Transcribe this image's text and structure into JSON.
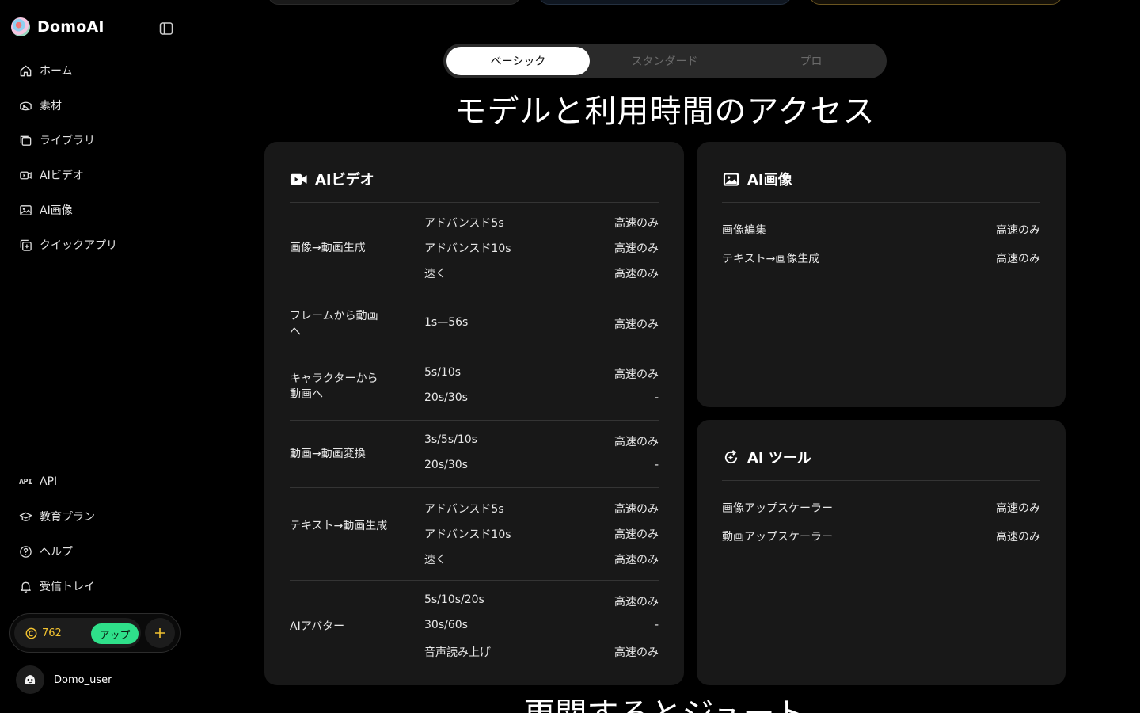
{
  "brand": {
    "name": "DomoAI"
  },
  "nav": {
    "items": [
      {
        "label": "ホーム",
        "icon": "home-icon"
      },
      {
        "label": "素材",
        "icon": "assets-icon"
      },
      {
        "label": "ライブラリ",
        "icon": "library-icon"
      },
      {
        "label": "AIビデオ",
        "icon": "video-icon"
      },
      {
        "label": "AI画像",
        "icon": "image-icon"
      },
      {
        "label": "クイックアプリ",
        "icon": "quick-app-icon"
      }
    ],
    "bottom": [
      {
        "label": "API",
        "icon": "api-icon"
      },
      {
        "label": "教育プラン",
        "icon": "education-icon"
      },
      {
        "label": "ヘルプ",
        "icon": "help-icon"
      },
      {
        "label": "受信トレイ",
        "icon": "bell-icon"
      }
    ]
  },
  "credits": {
    "count": "762",
    "upgrade_label": "アップ"
  },
  "user": {
    "name": "Domo_user"
  },
  "tabs": [
    {
      "label": "ベーシック",
      "active": true
    },
    {
      "label": "スタンダード",
      "active": false
    },
    {
      "label": "プロ",
      "active": false
    }
  ],
  "section_title": "モデルと利用時間のアクセス",
  "video_card": {
    "title": "AIビデオ",
    "groups": [
      {
        "name": "画像→動画生成",
        "rows": [
          {
            "option": "アドバンスド5s",
            "speed": "高速のみ"
          },
          {
            "option": "アドバンスド10s",
            "speed": "高速のみ"
          },
          {
            "option": "速く",
            "speed": "高速のみ"
          }
        ]
      },
      {
        "name": "フレームから動画へ",
        "rows": [
          {
            "option": "1s—56s",
            "speed": "高速のみ"
          }
        ]
      },
      {
        "name": "キャラクターから動画へ",
        "rows": [
          {
            "option": "5s/10s",
            "speed": "高速のみ"
          },
          {
            "option": "20s/30s",
            "speed": "-"
          }
        ]
      },
      {
        "name": "動画→動画変換",
        "rows": [
          {
            "option": "3s/5s/10s",
            "speed": "高速のみ"
          },
          {
            "option": "20s/30s",
            "speed": "-"
          }
        ]
      },
      {
        "name": "テキスト→動画生成",
        "rows": [
          {
            "option": "アドバンスド5s",
            "speed": "高速のみ"
          },
          {
            "option": "アドバンスド10s",
            "speed": "高速のみ"
          },
          {
            "option": "速く",
            "speed": "高速のみ"
          }
        ]
      },
      {
        "name": "AIアバター",
        "rows": [
          {
            "option": "5s/10s/20s",
            "speed": "高速のみ"
          },
          {
            "option": "30s/60s",
            "speed": "-"
          },
          {
            "option": "音声読み上げ",
            "speed": "高速のみ"
          }
        ]
      }
    ]
  },
  "image_card": {
    "title": "AI画像",
    "rows": [
      {
        "label": "画像編集",
        "speed": "高速のみ"
      },
      {
        "label": "テキスト→画像生成",
        "speed": "高速のみ"
      }
    ]
  },
  "tools_card": {
    "title": "AI ツール",
    "rows": [
      {
        "label": "画像アップスケーラー",
        "speed": "高速のみ"
      },
      {
        "label": "動画アップスケーラー",
        "speed": "高速のみ"
      }
    ]
  },
  "next_section_title": "更関するとジュート",
  "colors": {
    "accent_green": "#2fe08a",
    "coin_gold": "#f2c230",
    "card_bg": "#181818"
  }
}
